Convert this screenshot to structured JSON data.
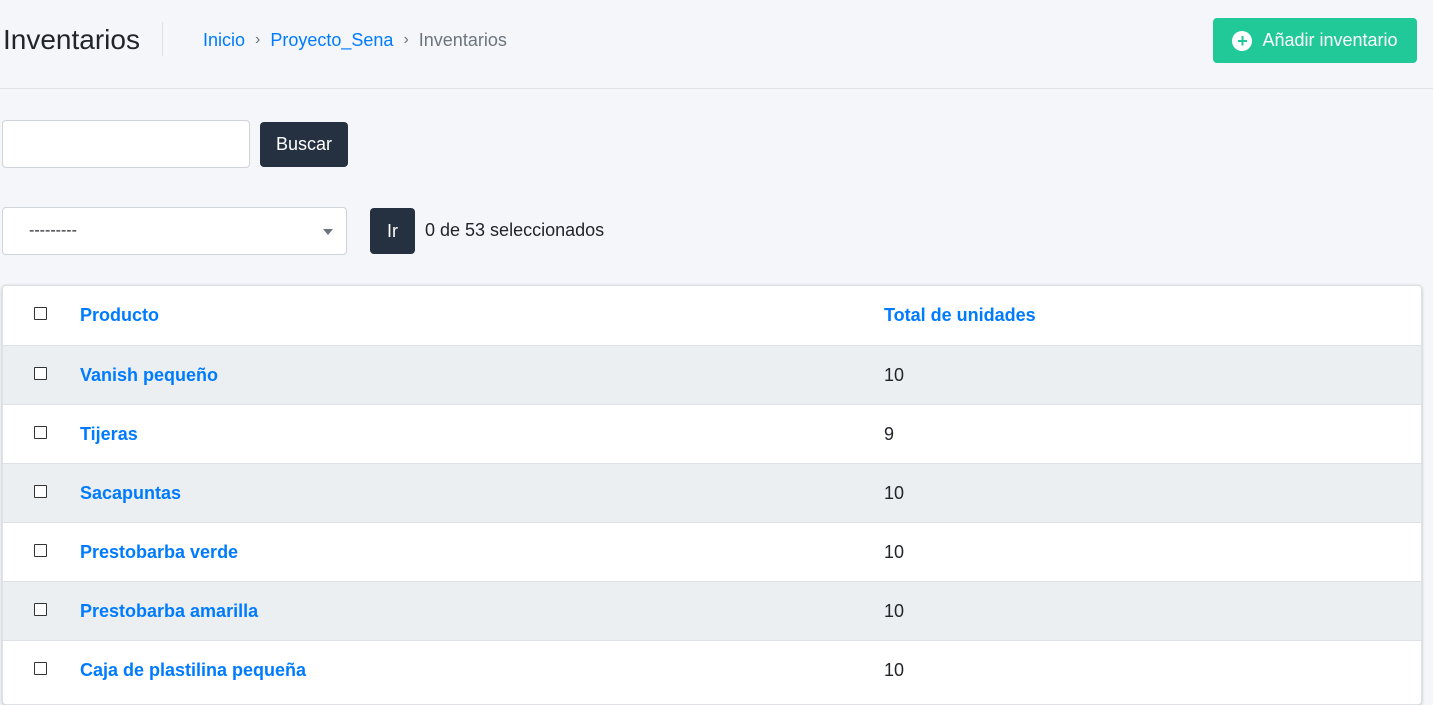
{
  "header": {
    "title": "Inventarios",
    "breadcrumb": {
      "home": "Inicio",
      "separator": "›",
      "project": "Proyecto_Sena",
      "current": "Inventarios"
    },
    "add_button_label": "Añadir inventario",
    "add_icon": "plus-circle-icon",
    "accent_color": "#20c997"
  },
  "search": {
    "value": "",
    "placeholder": "",
    "button_label": "Buscar"
  },
  "actions": {
    "selected_action": "---------",
    "go_label": "Ir",
    "selection_count": "0 de 53 seleccionados"
  },
  "table": {
    "columns": {
      "product": "Producto",
      "units": "Total de unidades"
    },
    "rows": [
      {
        "product": "Vanish pequeño",
        "units": "10"
      },
      {
        "product": "Tijeras",
        "units": "9"
      },
      {
        "product": "Sacapuntas",
        "units": "10"
      },
      {
        "product": "Prestobarba verde",
        "units": "10"
      },
      {
        "product": "Prestobarba amarilla",
        "units": "10"
      },
      {
        "product": "Caja de plastilina pequeña",
        "units": "10"
      }
    ]
  }
}
